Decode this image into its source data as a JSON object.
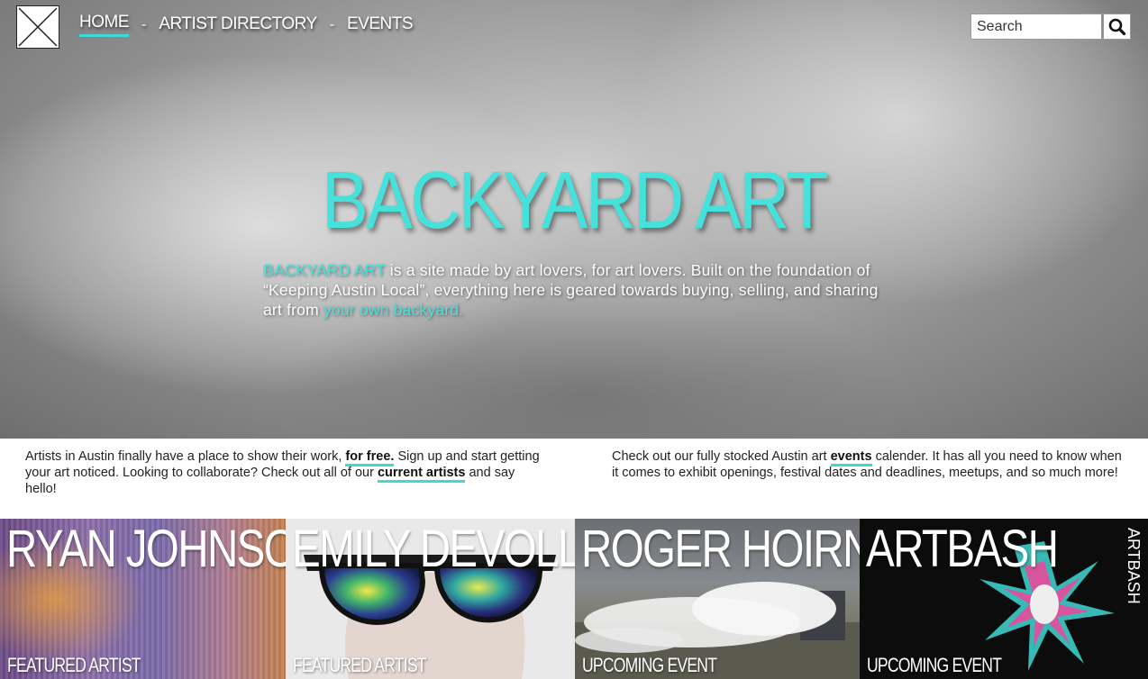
{
  "nav": {
    "home": "HOME",
    "sep1": "-",
    "directory": "ARTIST DIRECTORY",
    "sep2": "-",
    "events": "EVENTS"
  },
  "search": {
    "placeholder": "Search"
  },
  "hero": {
    "title": "BACKYARD ART",
    "intro_brand": "BACKYARD ART",
    "intro_text": " is a site made by art lovers, for art lovers. Built on the foundation of “Keeping Austin Local”, everything here is geared towards buying, selling, and sharing art from ",
    "intro_link": "your own backyard."
  },
  "info_left": {
    "text1": "Artists in Austin finally have a place to show their work, ",
    "link1": "for free.",
    "text2": " Sign up and start getting your art noticed. Looking to collaborate? Check out all of our ",
    "link2": "current artists",
    "text3": " and say hello!"
  },
  "info_right": {
    "text1": "Check out our fully stocked Austin art ",
    "link1": "events",
    "text2": " calender. It has all you need to know when it comes to exhibit openings, festival dates and deadlines, meetups, and so much more!"
  },
  "cards": [
    {
      "name": "RYAN JOHNSON",
      "tag": "FEATURED ARTIST"
    },
    {
      "name": "EMILY DEVOLL",
      "tag": "FEATURED ARTIST"
    },
    {
      "name": "ROGER HOIRNS",
      "tag": "UPCOMING EVENT"
    },
    {
      "name": "ARTBASH",
      "tag": "UPCOMING EVENT",
      "side_text": "ARTBASH"
    }
  ],
  "colors": {
    "accent": "#45e2dc",
    "underline": "#3fd8d3"
  },
  "icons": {
    "logo": "x-logo-icon",
    "search": "search-icon"
  }
}
